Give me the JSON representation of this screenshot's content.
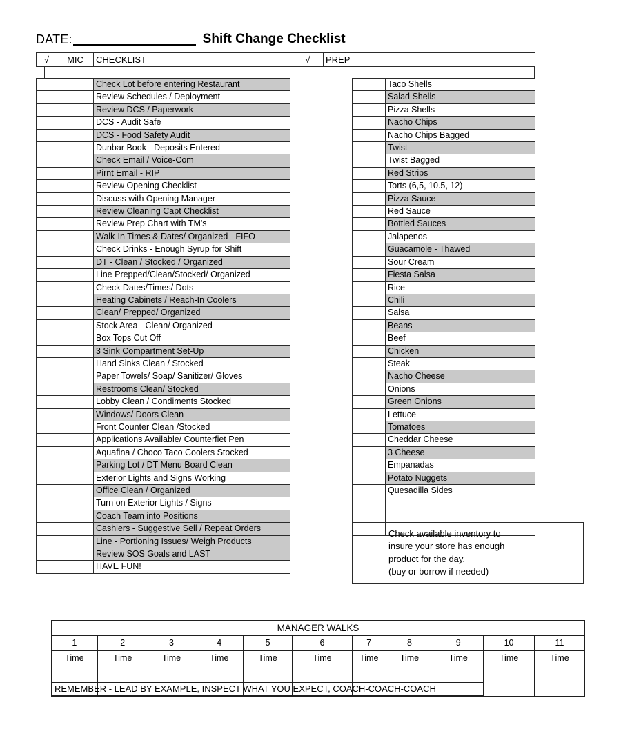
{
  "document": {
    "date_label": "DATE:",
    "date_value": "",
    "title": "Shift Change Checklist"
  },
  "headers": {
    "check_left": "√",
    "mic": "MIC",
    "checklist": "CHECKLIST",
    "check_right": "√",
    "prep": "PREP"
  },
  "checklist": {
    "items": [
      {
        "label": "Check Lot before entering Restaurant",
        "shaded": true,
        "check": "",
        "mic": ""
      },
      {
        "label": "Review Schedules / Deployment",
        "shaded": false,
        "check": "",
        "mic": ""
      },
      {
        "label": "Review DCS / Paperwork",
        "shaded": true,
        "check": "",
        "mic": ""
      },
      {
        "label": "DCS - Audit Safe",
        "shaded": false,
        "check": "",
        "mic": ""
      },
      {
        "label": "DCS - Food Safety Audit",
        "shaded": true,
        "check": "",
        "mic": ""
      },
      {
        "label": "Dunbar Book - Deposits Entered",
        "shaded": false,
        "check": "",
        "mic": ""
      },
      {
        "label": "Check Email / Voice-Com",
        "shaded": true,
        "check": "",
        "mic": ""
      },
      {
        "label": "Pirnt Email - RIP",
        "shaded": true,
        "check": "",
        "mic": ""
      },
      {
        "label": "Review Opening Checklist",
        "shaded": false,
        "check": "",
        "mic": ""
      },
      {
        "label": "Discuss with Opening Manager",
        "shaded": false,
        "check": "",
        "mic": ""
      },
      {
        "label": "Review Cleaning Capt Checklist",
        "shaded": true,
        "check": "",
        "mic": ""
      },
      {
        "label": "Review Prep Chart with TM's",
        "shaded": false,
        "check": "",
        "mic": ""
      },
      {
        "label": "Walk-In Times & Dates/ Organized - FIFO",
        "shaded": true,
        "check": "",
        "mic": ""
      },
      {
        "label": "Check Drinks - Enough Syrup for Shift",
        "shaded": false,
        "check": "",
        "mic": ""
      },
      {
        "label": "DT - Clean / Stocked / Organized",
        "shaded": true,
        "check": "",
        "mic": ""
      },
      {
        "label": "Line Prepped/Clean/Stocked/ Organized",
        "shaded": false,
        "check": "",
        "mic": ""
      },
      {
        "label": "Check Dates/Times/ Dots",
        "shaded": false,
        "check": "",
        "mic": ""
      },
      {
        "label": "Heating Cabinets / Reach-In Coolers",
        "shaded": true,
        "check": "",
        "mic": ""
      },
      {
        "label": "Clean/ Prepped/ Organized",
        "shaded": true,
        "check": "",
        "mic": ""
      },
      {
        "label": "Stock Area - Clean/ Organized",
        "shaded": false,
        "check": "",
        "mic": ""
      },
      {
        "label": "Box Tops Cut Off",
        "shaded": false,
        "check": "",
        "mic": ""
      },
      {
        "label": "3 Sink Compartment Set-Up",
        "shaded": true,
        "check": "",
        "mic": ""
      },
      {
        "label": "Hand Sinks Clean / Stocked",
        "shaded": false,
        "check": "",
        "mic": ""
      },
      {
        "label": "Paper Towels/ Soap/ Sanitizer/ Gloves",
        "shaded": false,
        "check": "",
        "mic": ""
      },
      {
        "label": "Restrooms Clean/ Stocked",
        "shaded": true,
        "check": "",
        "mic": ""
      },
      {
        "label": "Lobby Clean / Condiments Stocked",
        "shaded": false,
        "check": "",
        "mic": ""
      },
      {
        "label": "Windows/ Doors Clean",
        "shaded": true,
        "check": "",
        "mic": ""
      },
      {
        "label": "Front Counter Clean /Stocked",
        "shaded": false,
        "check": "",
        "mic": ""
      },
      {
        "label": "Applications Available/ Counterfiet Pen",
        "shaded": false,
        "check": "",
        "mic": ""
      },
      {
        "label": "Aquafina / Choco Taco Coolers Stocked",
        "shaded": false,
        "check": "",
        "mic": ""
      },
      {
        "label": "Parking Lot / DT Menu Board Clean",
        "shaded": true,
        "check": "",
        "mic": ""
      },
      {
        "label": "Exterior Lights and Signs Working",
        "shaded": false,
        "check": "",
        "mic": ""
      },
      {
        "label": "Office Clean / Organized",
        "shaded": true,
        "check": "",
        "mic": ""
      },
      {
        "label": "Turn on Exterior Lights / Signs",
        "shaded": false,
        "check": "",
        "mic": ""
      },
      {
        "label": "Coach Team into Positions",
        "shaded": true,
        "check": "",
        "mic": ""
      },
      {
        "label": "Cashiers - Suggestive Sell / Repeat Orders",
        "shaded": true,
        "check": "",
        "mic": ""
      },
      {
        "label": "Line - Portioning Issues/ Weigh Products",
        "shaded": true,
        "check": "",
        "mic": ""
      },
      {
        "label": "Review SOS Goals and LAST",
        "shaded": true,
        "check": "",
        "mic": ""
      },
      {
        "label": "HAVE FUN!",
        "shaded": false,
        "check": "",
        "mic": ""
      }
    ]
  },
  "prep": {
    "items": [
      {
        "label": "Taco Shells",
        "shaded": false,
        "check": ""
      },
      {
        "label": "Salad Shells",
        "shaded": true,
        "check": ""
      },
      {
        "label": "Pizza Shells",
        "shaded": false,
        "check": ""
      },
      {
        "label": "Nacho Chips",
        "shaded": true,
        "check": ""
      },
      {
        "label": "Nacho Chips Bagged",
        "shaded": false,
        "check": ""
      },
      {
        "label": "Twist",
        "shaded": true,
        "check": ""
      },
      {
        "label": "Twist Bagged",
        "shaded": false,
        "check": ""
      },
      {
        "label": "Red Strips",
        "shaded": true,
        "check": ""
      },
      {
        "label": "Torts (6,5, 10.5, 12)",
        "shaded": false,
        "check": ""
      },
      {
        "label": "Pizza Sauce",
        "shaded": true,
        "check": ""
      },
      {
        "label": "Red Sauce",
        "shaded": false,
        "check": ""
      },
      {
        "label": "Bottled Sauces",
        "shaded": true,
        "check": ""
      },
      {
        "label": "Jalapenos",
        "shaded": false,
        "check": ""
      },
      {
        "label": "Guacamole - Thawed",
        "shaded": true,
        "check": ""
      },
      {
        "label": "Sour Cream",
        "shaded": false,
        "check": ""
      },
      {
        "label": "Fiesta Salsa",
        "shaded": true,
        "check": ""
      },
      {
        "label": "Rice",
        "shaded": false,
        "check": ""
      },
      {
        "label": "Chili",
        "shaded": true,
        "check": ""
      },
      {
        "label": "Salsa",
        "shaded": false,
        "check": ""
      },
      {
        "label": "Beans",
        "shaded": true,
        "check": ""
      },
      {
        "label": "Beef",
        "shaded": false,
        "check": ""
      },
      {
        "label": "Chicken",
        "shaded": true,
        "check": ""
      },
      {
        "label": "Steak",
        "shaded": false,
        "check": ""
      },
      {
        "label": "Nacho Cheese",
        "shaded": true,
        "check": ""
      },
      {
        "label": "Onions",
        "shaded": false,
        "check": ""
      },
      {
        "label": "Green Onions",
        "shaded": true,
        "check": ""
      },
      {
        "label": "Lettuce",
        "shaded": false,
        "check": ""
      },
      {
        "label": "Tomatoes",
        "shaded": true,
        "check": ""
      },
      {
        "label": "Cheddar Cheese",
        "shaded": false,
        "check": ""
      },
      {
        "label": "3 Cheese",
        "shaded": true,
        "check": ""
      },
      {
        "label": "Empanadas",
        "shaded": false,
        "check": ""
      },
      {
        "label": "Potato Nuggets",
        "shaded": true,
        "check": ""
      },
      {
        "label": "Quesadilla Sides",
        "shaded": false,
        "check": ""
      },
      {
        "label": "",
        "shaded": false,
        "check": ""
      },
      {
        "label": "",
        "shaded": false,
        "check": ""
      },
      {
        "label": "",
        "shaded": false,
        "check": ""
      }
    ]
  },
  "inventory_note": {
    "lines": [
      "Check available inventory to",
      "insure your store has enough",
      "product for the day.",
      "(buy or borrow if needed)"
    ]
  },
  "manager_walks": {
    "title": "MANAGER WALKS",
    "numbers": [
      "1",
      "2",
      "3",
      "4",
      "5",
      "6",
      "7",
      "8",
      "9",
      "10",
      "11"
    ],
    "time_labels": [
      "Time",
      "Time",
      "Time",
      "Time",
      "Time",
      "Time",
      "Time",
      "Time",
      "Time",
      "Time",
      "Time"
    ],
    "row_blank_1": [
      "",
      "",
      "",
      "",
      "",
      "",
      "",
      "",
      "",
      "",
      ""
    ],
    "row_blank_2": [
      "",
      "",
      "",
      "",
      "",
      "",
      "",
      "",
      "",
      "",
      ""
    ],
    "remember": "REMEMBER - LEAD BY EXAMPLE, INSPECT WHAT YOU EXPECT, COACH-COACH-COACH"
  },
  "colors": {
    "shade": "#c9c9c9",
    "border": "#2b2b2b",
    "text": "#000000"
  }
}
